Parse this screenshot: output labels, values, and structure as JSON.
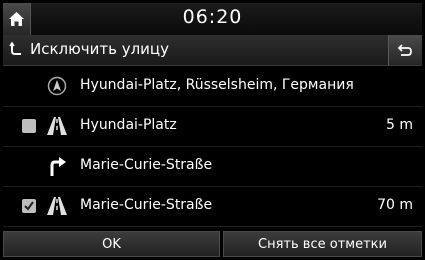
{
  "status": {
    "time": "06:20"
  },
  "titlebar": {
    "title": "Исключить улицу"
  },
  "route": {
    "items": [
      {
        "type": "destination",
        "text": "Hyundai-Platz, Rüsselsheim, Германия",
        "distance": "",
        "checked": null
      },
      {
        "type": "road",
        "text": "Hyundai-Platz",
        "distance": "5 m",
        "checked": false
      },
      {
        "type": "turn-right",
        "text": "Marie-Curie-Straße",
        "distance": "",
        "checked": null
      },
      {
        "type": "road",
        "text": "Marie-Curie-Straße",
        "distance": "70 m",
        "checked": true
      }
    ]
  },
  "buttons": {
    "ok": "OK",
    "clear_all": "Снять все отметки"
  }
}
